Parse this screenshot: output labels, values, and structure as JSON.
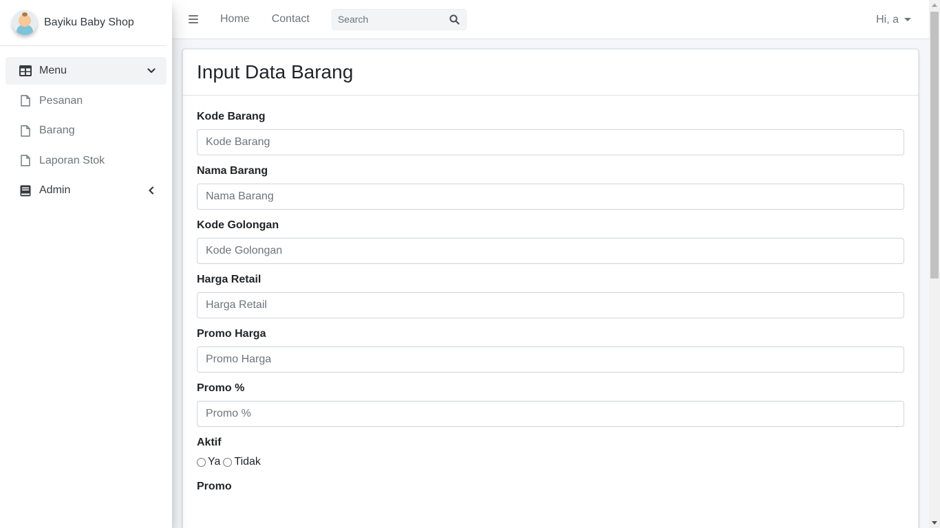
{
  "brand": {
    "name": "Bayiku Baby Shop"
  },
  "sidebar": {
    "items": [
      {
        "label": "Menu",
        "icon": "table-icon",
        "expanded": true
      },
      {
        "label": "Pesanan",
        "icon": "file-icon"
      },
      {
        "label": "Barang",
        "icon": "file-icon"
      },
      {
        "label": "Laporan Stok",
        "icon": "file-icon"
      },
      {
        "label": "Admin",
        "icon": "book-icon",
        "expanded": false
      }
    ]
  },
  "topbar": {
    "links": [
      "Home",
      "Contact"
    ],
    "search_placeholder": "Search",
    "user_label": "Hi, a"
  },
  "page": {
    "title": "Input Data Barang",
    "fields": [
      {
        "label": "Kode Barang",
        "placeholder": "Kode Barang"
      },
      {
        "label": "Nama Barang",
        "placeholder": "Nama Barang"
      },
      {
        "label": "Kode Golongan",
        "placeholder": "Kode Golongan"
      },
      {
        "label": "Harga Retail",
        "placeholder": "Harga Retail"
      },
      {
        "label": "Promo Harga",
        "placeholder": "Promo Harga"
      },
      {
        "label": "Promo %",
        "placeholder": "Promo %"
      }
    ],
    "aktif": {
      "label": "Aktif",
      "options": [
        "Ya",
        "Tidak"
      ]
    },
    "promo": {
      "label": "Promo"
    }
  },
  "colors": {
    "sidebar_bg": "#ffffff",
    "active_bg": "#f1f3f5",
    "text": "#212529",
    "muted": "#6c757d"
  }
}
